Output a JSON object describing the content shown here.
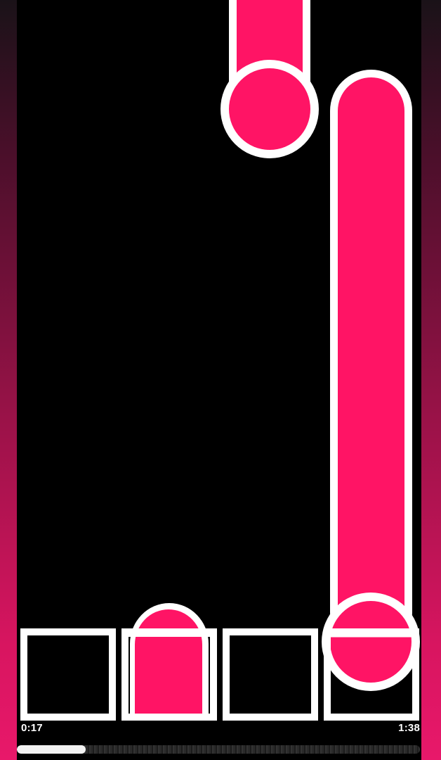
{
  "game": {
    "lanes": 4,
    "accent_color": "#ff1465",
    "outline_color": "#ffffff"
  },
  "hud": {
    "time_elapsed": "0:17",
    "time_total": "1:38",
    "progress": 0.17
  }
}
